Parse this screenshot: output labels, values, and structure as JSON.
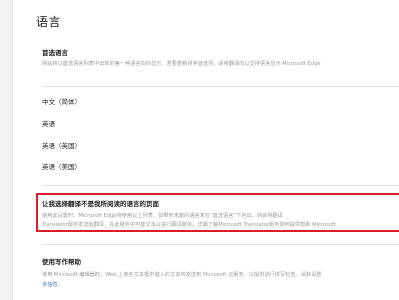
{
  "page": {
    "title": "语言"
  },
  "preferred_languages": {
    "heading": "首选语言",
    "description": "网站将以首选语言列表中出现的第一种语言向你显示。若要重新排序首选项，请将翻译向以支持语言显示 Microsoft Edge"
  },
  "languages": [
    {
      "label": "中文（简体）"
    },
    {
      "label": "英语"
    },
    {
      "label": "英语（英国）"
    },
    {
      "label": "英语（美国）"
    }
  ],
  "translate": {
    "heading": "让我选择翻译不是我所阅读的语言的页面",
    "description_line1": "使用此设置时，Microsoft Edge将使用以上列表，如果你未能的语言未在“首选语言”下列出，则会将翻译",
    "description_line2": "Translator服务发送给翻译，在此服务中可能文本以进行翻译服务。详细了解Microsoft Translator服务如何提供帮助 Microsoft"
  },
  "writing_help": {
    "heading": "使用写作帮助",
    "description_line1": "使用 Microsoft 编辑器时，Web 上某些文本框中键入的文本将发送到 Microsoft 云服务，以提供进行拼写检查。请获设置",
    "description_line2": "多信息。"
  }
}
